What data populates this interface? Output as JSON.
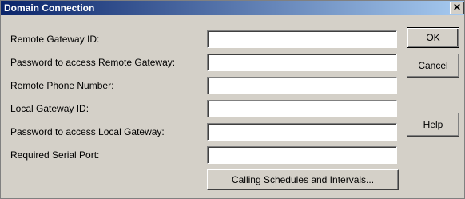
{
  "window": {
    "title": "Domain Connection",
    "close_glyph": "✕"
  },
  "form": {
    "fields": [
      {
        "label": "Remote Gateway ID:",
        "value": ""
      },
      {
        "label": "Password to access Remote Gateway:",
        "value": ""
      },
      {
        "label": "Remote Phone Number:",
        "value": ""
      },
      {
        "label": "Local Gateway ID:",
        "value": ""
      },
      {
        "label": "Password to access Local Gateway:",
        "value": ""
      },
      {
        "label": "Required Serial Port:",
        "value": ""
      }
    ],
    "schedules_button": "Calling Schedules and Intervals..."
  },
  "buttons": {
    "ok": "OK",
    "cancel": "Cancel",
    "help": "Help"
  }
}
